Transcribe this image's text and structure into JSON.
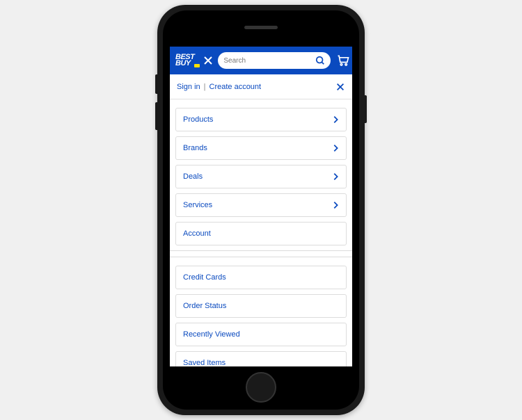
{
  "header": {
    "logo_line1": "BEST",
    "logo_line2": "BUY",
    "search_placeholder": "Search"
  },
  "auth": {
    "sign_in": "Sign in",
    "create_account": "Create account"
  },
  "menu_primary": [
    {
      "label": "Products",
      "has_chevron": true
    },
    {
      "label": "Brands",
      "has_chevron": true
    },
    {
      "label": "Deals",
      "has_chevron": true
    },
    {
      "label": "Services",
      "has_chevron": true
    },
    {
      "label": "Account",
      "has_chevron": false
    }
  ],
  "menu_secondary": [
    {
      "label": "Credit Cards"
    },
    {
      "label": "Order Status"
    },
    {
      "label": "Recently Viewed"
    },
    {
      "label": "Saved Items"
    }
  ]
}
